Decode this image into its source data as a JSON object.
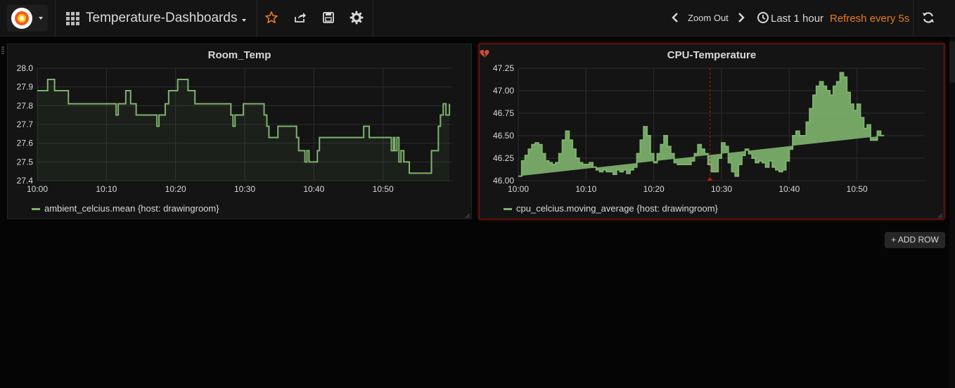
{
  "navbar": {
    "dashboard_title": "Temperature-Dashboards",
    "zoom_out_label": "Zoom Out",
    "time_range_label": "Last 1 hour",
    "refresh_label": "Refresh every 5s"
  },
  "colors": {
    "series_green": "#7eb26d",
    "accent_orange": "#eb7b18",
    "alert_red": "#bf1b00",
    "panel_bg": "#141414",
    "page_bg": "#050505"
  },
  "icons": [
    "grafana-logo-icon",
    "dashboard-grid-icon",
    "star-icon",
    "share-icon",
    "save-icon",
    "gear-icon",
    "chevron-left-icon",
    "chevron-right-icon",
    "clock-icon",
    "refresh-icon",
    "plus-icon",
    "broken-heart-icon"
  ],
  "add_row_label": "+ ADD ROW",
  "chart_data": [
    {
      "type": "line",
      "title": "Room_Temp",
      "xlabel": "",
      "ylabel": "",
      "ylim": [
        27.4,
        28.0
      ],
      "y_ticks": [
        "28.0",
        "27.9",
        "27.8",
        "27.7",
        "27.6",
        "27.5",
        "27.4"
      ],
      "x_ticks": [
        "10:00",
        "10:10",
        "10:20",
        "10:30",
        "10:40",
        "10:50"
      ],
      "grid": true,
      "legend_position": "bottom-left",
      "series": [
        {
          "name": "ambient_celcius.mean {host: drawingroom}",
          "color": "#7eb26d",
          "x_minutes": [
            0,
            1.2,
            1.5,
            2.2,
            2.5,
            4.5,
            11,
            11.4,
            11.7,
            12.5,
            12.8,
            13.1,
            13.5,
            14,
            14.3,
            17,
            17.3,
            17.6,
            18,
            18.5,
            18.8,
            19,
            19.4,
            20,
            20.3,
            21.5,
            21.8,
            22.5,
            22.8,
            27.5,
            28,
            28.3,
            28.6,
            29.5,
            29.8,
            32.5,
            32.8,
            33.2,
            33.5,
            34.5,
            34.8,
            37.5,
            37.8,
            38.5,
            38.7,
            39,
            39.3,
            40.5,
            40.8,
            47,
            47.2,
            48,
            48.3,
            51,
            51.2,
            51.5,
            51.7,
            52,
            52.3,
            52.6,
            53,
            53.5,
            53.8,
            55.5,
            57,
            58,
            58.3,
            58.7,
            59.1,
            59.4,
            59.6
          ],
          "values": [
            27.88,
            27.88,
            27.94,
            27.94,
            27.88,
            27.81,
            27.81,
            27.75,
            27.81,
            27.81,
            27.88,
            27.88,
            27.81,
            27.81,
            27.75,
            27.75,
            27.69,
            27.75,
            27.75,
            27.81,
            27.81,
            27.88,
            27.88,
            27.88,
            27.94,
            27.94,
            27.88,
            27.88,
            27.81,
            27.81,
            27.75,
            27.69,
            27.75,
            27.75,
            27.81,
            27.81,
            27.75,
            27.69,
            27.63,
            27.63,
            27.69,
            27.63,
            27.56,
            27.56,
            27.5,
            27.56,
            27.5,
            27.56,
            27.63,
            27.63,
            27.69,
            27.63,
            27.63,
            27.63,
            27.56,
            27.63,
            27.56,
            27.63,
            27.5,
            27.56,
            27.5,
            27.5,
            27.44,
            27.44,
            27.56,
            27.69,
            27.75,
            27.81,
            27.75,
            27.75,
            27.81
          ]
        }
      ]
    },
    {
      "type": "area",
      "title": "CPU-Temperature",
      "xlabel": "",
      "ylabel": "",
      "ylim": [
        46.0,
        47.25
      ],
      "y_ticks": [
        "47.25",
        "47.00",
        "46.75",
        "46.50",
        "46.25",
        "46.00"
      ],
      "x_ticks": [
        "10:00",
        "10:10",
        "10:20",
        "10:30",
        "10:40",
        "10:50"
      ],
      "grid": true,
      "legend_position": "bottom-left",
      "alert_marker_minute": 28.3,
      "series": [
        {
          "name": "cpu_celcius.moving_average {host: drawingroom}",
          "color": "#7eb26d",
          "x_minutes": [
            0,
            0.5,
            1,
            1.5,
            2,
            2.5,
            3,
            3.5,
            4,
            4.5,
            5,
            5.5,
            6,
            6.5,
            7,
            7.5,
            8,
            8.5,
            9,
            9.5,
            10,
            10.5,
            11,
            11.5,
            12,
            12.5,
            13,
            13.5,
            14,
            14.5,
            15,
            15.5,
            16,
            16.5,
            17,
            17.5,
            18,
            18.5,
            19,
            19.5,
            20,
            20.5,
            21,
            21.5,
            22,
            22.5,
            23,
            23.5,
            24,
            24.5,
            25,
            25.5,
            26,
            26.5,
            27,
            27.5,
            28,
            28.5,
            29,
            29.5,
            30,
            30.5,
            31,
            31.5,
            32,
            32.5,
            33,
            33.5,
            34,
            34.5,
            35,
            35.5,
            36,
            36.5,
            37,
            37.5,
            38,
            38.5,
            39,
            39.5,
            40,
            40.5,
            41,
            41.5,
            42,
            42.5,
            43,
            43.5,
            44,
            44.5,
            45,
            45.5,
            46,
            46.5,
            47,
            47.5,
            48,
            48.5,
            49,
            49.5,
            50,
            50.5,
            51,
            51.5,
            52,
            52.5,
            53,
            53.5,
            54,
            54.5,
            55,
            55.5,
            56,
            56.5,
            57,
            57.5,
            58,
            58.5,
            59,
            59.5
          ],
          "values": [
            46.05,
            46.22,
            46.28,
            46.35,
            46.4,
            46.42,
            46.4,
            46.3,
            46.22,
            46.2,
            46.18,
            46.2,
            46.3,
            46.45,
            46.55,
            46.45,
            46.35,
            46.25,
            46.2,
            46.18,
            46.18,
            46.2,
            46.15,
            46.12,
            46.1,
            46.12,
            46.1,
            46.1,
            46.07,
            46.12,
            46.1,
            46.12,
            46.08,
            46.12,
            46.15,
            46.3,
            46.45,
            46.6,
            46.5,
            46.3,
            46.2,
            46.3,
            46.4,
            46.5,
            46.38,
            46.3,
            46.2,
            46.18,
            46.18,
            46.18,
            46.18,
            46.22,
            46.3,
            46.4,
            46.35,
            46.3,
            46.18,
            46.1,
            46.1,
            46.25,
            46.42,
            46.38,
            46.2,
            46.1,
            46.05,
            46.18,
            46.28,
            46.35,
            46.3,
            46.25,
            46.2,
            46.22,
            46.2,
            46.15,
            46.22,
            46.15,
            46.12,
            46.1,
            46.12,
            46.22,
            46.35,
            46.5,
            46.55,
            46.5,
            46.5,
            46.65,
            46.8,
            46.95,
            47.05,
            47.1,
            47.05,
            47.0,
            46.95,
            47.05,
            47.1,
            47.2,
            47.15,
            46.98,
            46.85,
            46.78,
            46.85,
            46.7,
            46.58,
            46.62,
            46.45,
            46.45,
            46.55,
            46.5
          ],
          "note": ""
        }
      ]
    }
  ]
}
